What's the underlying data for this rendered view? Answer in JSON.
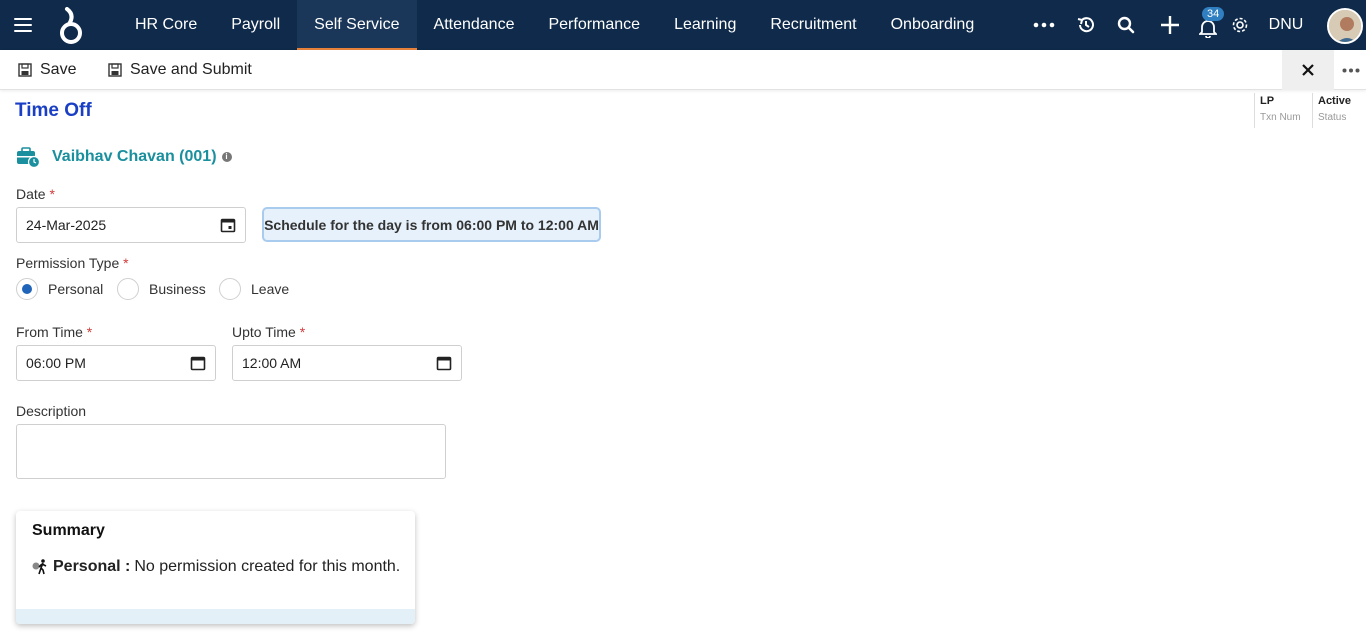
{
  "nav": {
    "items": [
      {
        "label": "HR Core"
      },
      {
        "label": "Payroll"
      },
      {
        "label": "Self Service"
      },
      {
        "label": "Attendance"
      },
      {
        "label": "Performance"
      },
      {
        "label": "Learning"
      },
      {
        "label": "Recruitment"
      },
      {
        "label": "Onboarding"
      }
    ],
    "active_item": "Self Service",
    "notification_count": "34",
    "user_initials": "DNU",
    "icons": [
      "menu-icon",
      "logo",
      "more-horizontal-icon",
      "history-icon",
      "search-icon",
      "plus-icon",
      "bell-icon",
      "gear-icon",
      "avatar"
    ]
  },
  "toolbar": {
    "save_label": "Save",
    "save_submit_label": "Save and Submit"
  },
  "page": {
    "title": "Time Off",
    "txn_num_value": "LP",
    "txn_num_label": "Txn Num",
    "status_value": "Active",
    "status_label": "Status"
  },
  "employee": {
    "name": "Vaibhav Chavan (001)"
  },
  "form": {
    "date_label": "Date",
    "date_value": "24-Mar-2025",
    "schedule_text": "Schedule for the day is from 06:00 PM to 12:00 AM",
    "permission_type_label": "Permission Type",
    "permission_options": [
      "Personal",
      "Business",
      "Leave"
    ],
    "permission_selected": "Personal",
    "from_time_label": "From Time",
    "from_time_value": "06:00 PM",
    "upto_time_label": "Upto Time",
    "upto_time_value": "12:00 AM",
    "description_label": "Description",
    "description_value": "",
    "required_mark": "*"
  },
  "summary": {
    "title": "Summary",
    "type_label": "Personal :",
    "message": "No permission created for this month."
  },
  "colors": {
    "nav_bg": "#0f2a4a",
    "active_underline": "#e8833a",
    "title_blue": "#1a3fc4",
    "employee_teal": "#1a8f9e",
    "radio_selected": "#1f64b8",
    "schedule_bg": "#e6f1fb"
  }
}
